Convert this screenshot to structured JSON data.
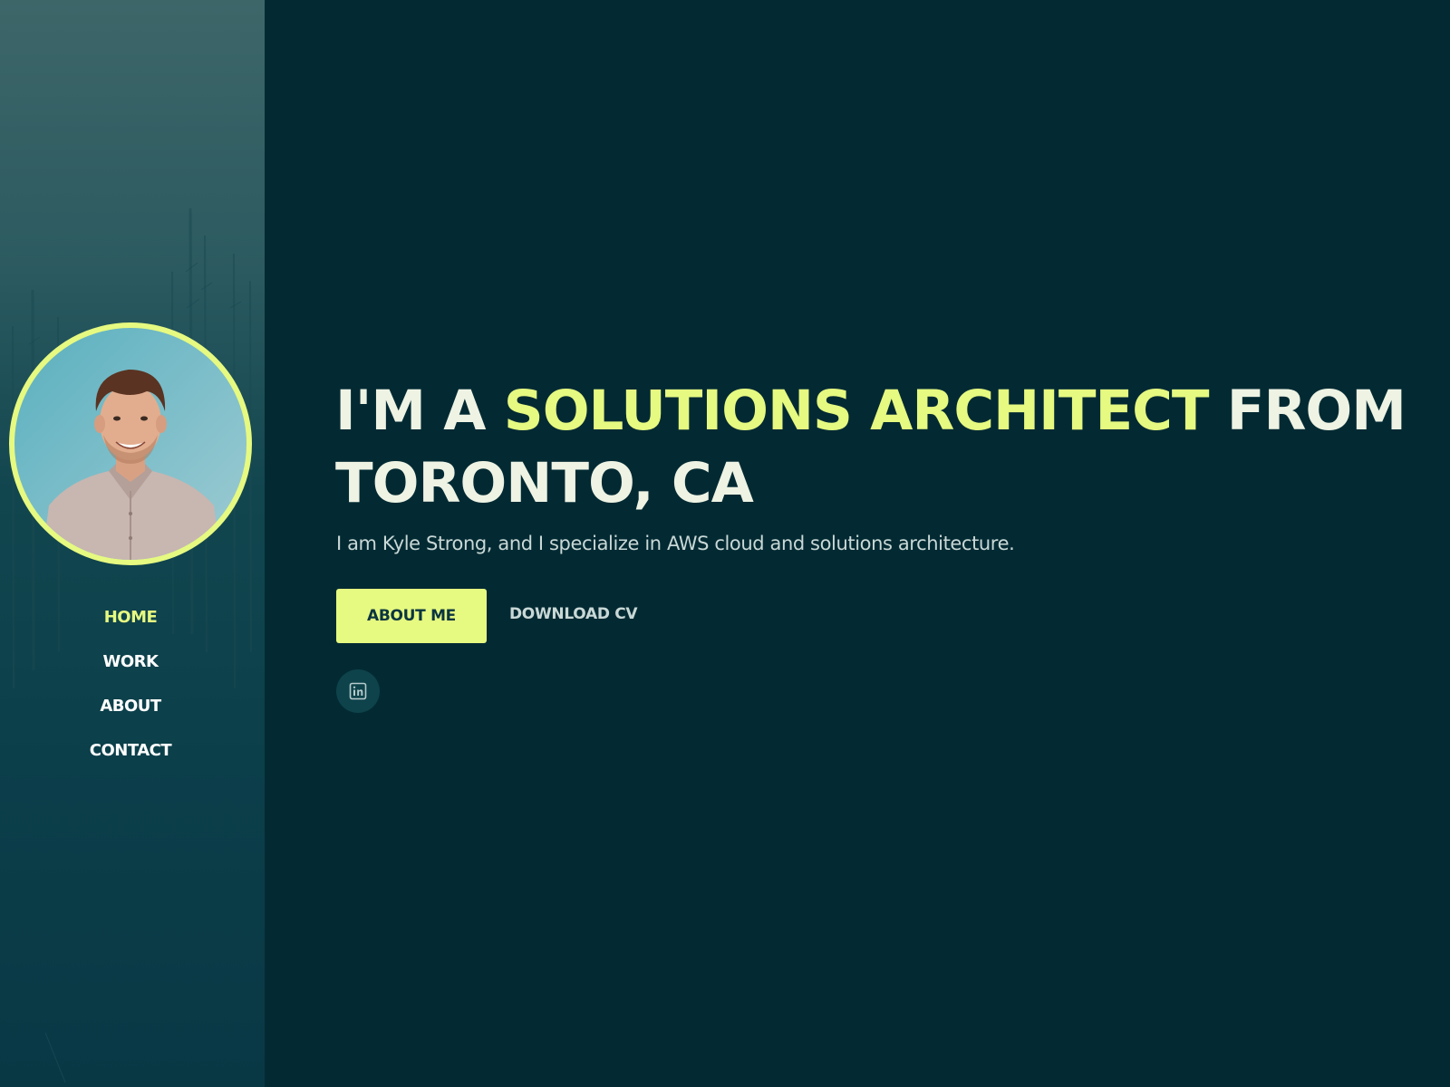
{
  "sidebar": {
    "nav": [
      {
        "label": "HOME",
        "active": true
      },
      {
        "label": "WORK",
        "active": false
      },
      {
        "label": "ABOUT",
        "active": false
      },
      {
        "label": "CONTACT",
        "active": false
      }
    ]
  },
  "hero": {
    "headline_prefix": "I'M A ",
    "headline_highlight": "SOLUTIONS ARCHITECT",
    "headline_suffix": " FROM TORONTO, CA",
    "tagline": "I am Kyle Strong, and I specialize in AWS cloud and solutions architecture.",
    "primary_button": "ABOUT ME",
    "secondary_button": "DOWNLOAD CV"
  },
  "social": [
    {
      "icon": "linkedin-icon"
    }
  ],
  "colors": {
    "background": "#032a33",
    "accent": "#e6f980",
    "text": "#eef3e4",
    "muted": "#c9d8d6"
  }
}
